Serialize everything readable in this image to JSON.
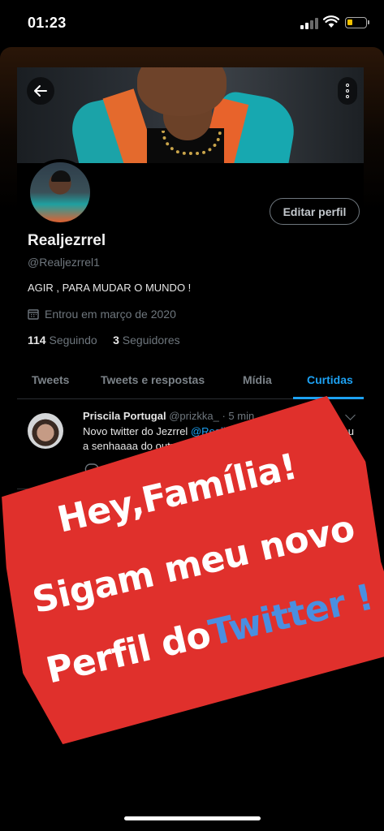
{
  "status_bar": {
    "time": "01:23"
  },
  "profile": {
    "edit_label": "Editar perfil",
    "name": "Realjezrrel",
    "handle": "@Realjezrrel1",
    "bio": "AGIR , PARA MUDAR O MUNDO !",
    "joined": "Entrou em março de 2020",
    "following_count": "114",
    "following_label": "Seguindo",
    "followers_count": "3",
    "followers_label": "Seguidores"
  },
  "tabs": [
    {
      "label": "Tweets"
    },
    {
      "label": "Tweets e respostas"
    },
    {
      "label": "Mídia"
    },
    {
      "label": "Curtidas",
      "active": true
    }
  ],
  "tweet": {
    "author": "Priscila Portugal",
    "handle": "@prizkka_",
    "separator": "·",
    "time": "5 min",
    "text_before": "Novo twitter do Jezrrel ",
    "mention": "@Realjezrrel1",
    "text_after": " pq a pessoa perdeu a senhaaaa do outro"
  },
  "sticker": {
    "line1": "Hey,Família!",
    "line2": "Sigam meu novo",
    "line3_a": "Perfil do",
    "line3_b": "Twitter",
    "line3_c": " !"
  },
  "colors": {
    "accent": "#1da1f2",
    "sticker_bg": "#e0302c",
    "sticker_blue": "#4a8fe0"
  },
  "icons": [
    "back-arrow-icon",
    "more-vertical-icon",
    "calendar-icon",
    "chevron-down-icon",
    "reply-icon",
    "retweet-icon"
  ]
}
